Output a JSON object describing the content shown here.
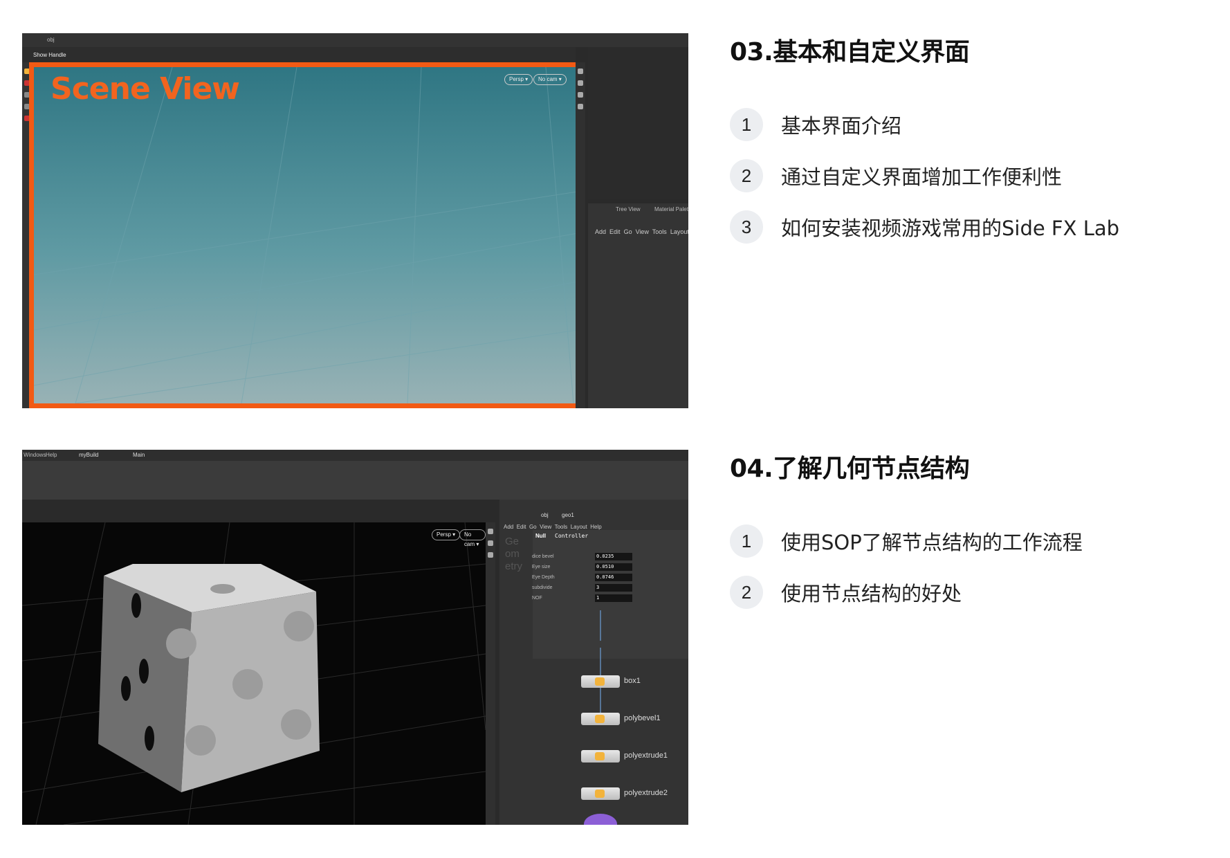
{
  "section1": {
    "title": "03.基本和自定义界面",
    "items": [
      {
        "num": "1",
        "text": "基本界面介绍"
      },
      {
        "num": "2",
        "text": "通过自定义界面增加工作便利性"
      },
      {
        "num": "3",
        "text": "如何安装视频游戏常用的Side FX Lab"
      }
    ]
  },
  "section2": {
    "title": "04.了解几何节点结构",
    "items": [
      {
        "num": "1",
        "text": "使用SOP了解节点结构的工作流程"
      },
      {
        "num": "2",
        "text": "使用节点结构的好处"
      }
    ]
  },
  "screenshot1": {
    "path": "obj",
    "show_handle": "Show Handle",
    "scene_label": "Scene View",
    "persp": "Persp ▾",
    "nocam": "No cam ▾",
    "tabs": [
      "Tree View",
      "Material Palette"
    ],
    "menu": [
      "Add",
      "Edit",
      "Go",
      "View",
      "Tools",
      "Layout"
    ]
  },
  "screenshot2": {
    "menubar": [
      "Windows",
      "Help"
    ],
    "desktop": "myBuild",
    "main": "Main",
    "persp": "Persp ▾",
    "nocam": "No cam ▾",
    "path": "obj",
    "geo": "geo1",
    "net_menu": [
      "Add",
      "Edit",
      "Go",
      "View",
      "Tools",
      "Layout",
      "Help"
    ],
    "geo_watermark": "Geometry",
    "node_type": "Null",
    "node_name": "Controller",
    "params": [
      {
        "label": "dice bevel",
        "value": "0.0235"
      },
      {
        "label": "Eye size",
        "value": "0.0510"
      },
      {
        "label": "Eye Depth",
        "value": "0.0746"
      },
      {
        "label": "subdivide",
        "value": "3"
      },
      {
        "label": "NOF",
        "value": "1"
      }
    ],
    "nodes": [
      "box1",
      "polybevel1",
      "polyextrude1",
      "polyextrude2"
    ],
    "colors": {
      "accent": "#f25a14",
      "viewport_top": "#2f7683"
    }
  }
}
